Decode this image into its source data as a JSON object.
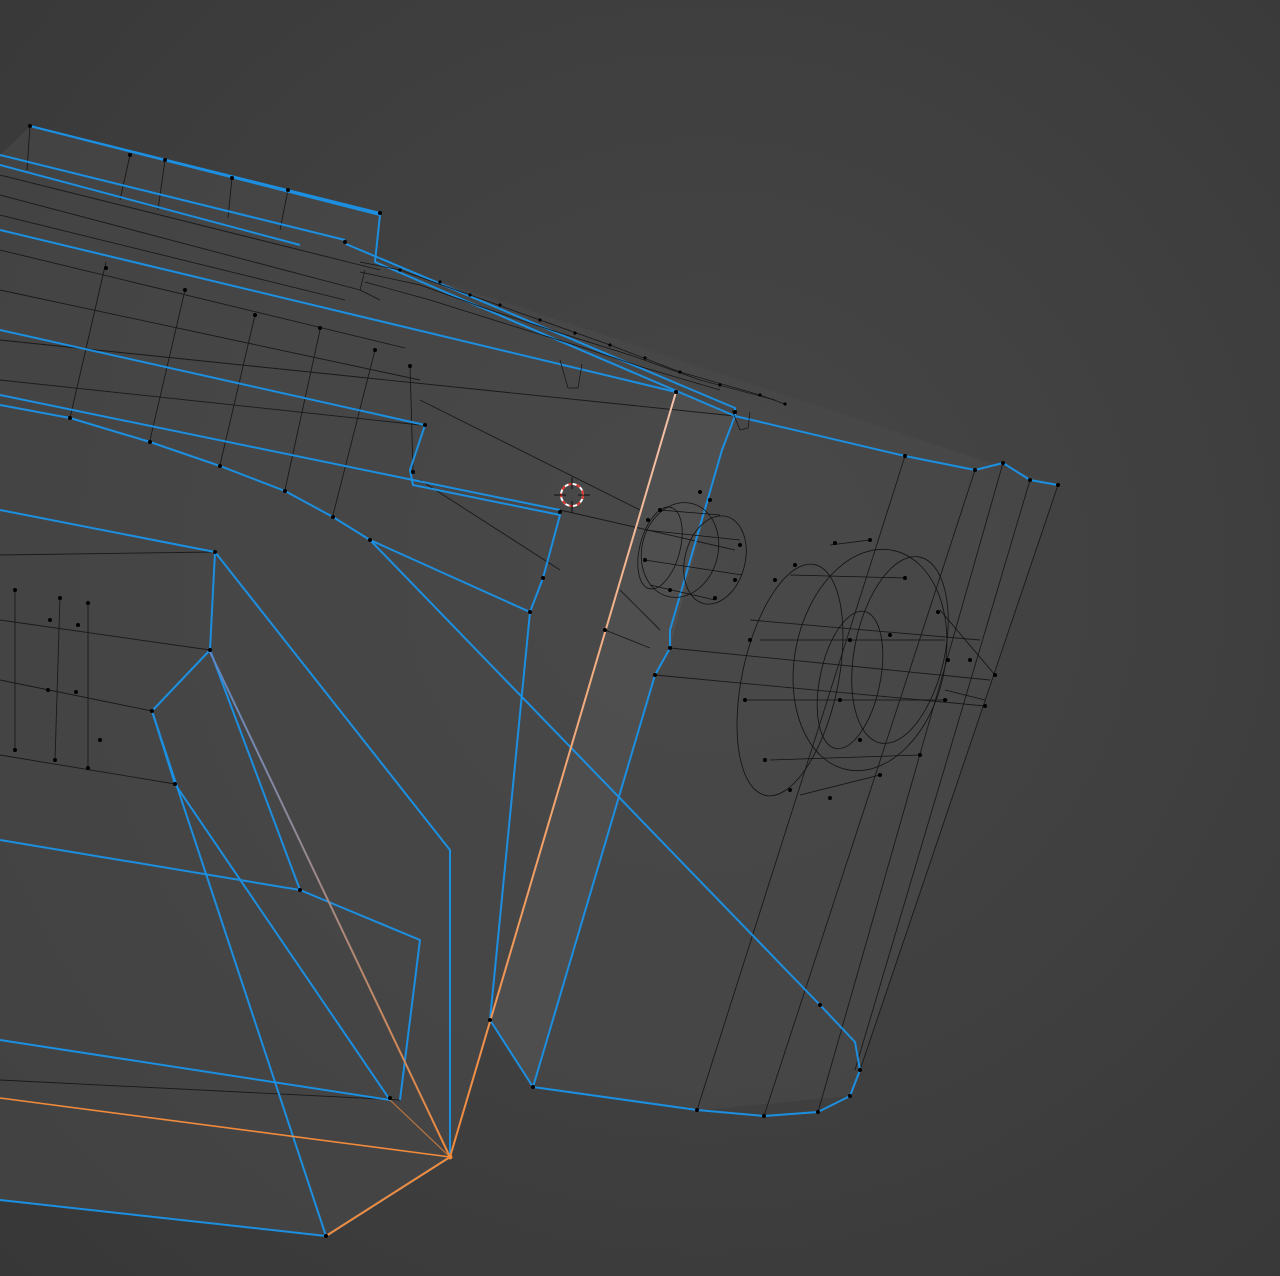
{
  "viewport": {
    "mode": "edit-mode-wireframe",
    "background_color": "#3d3d3d",
    "face_fill_color": "#4a4a4a",
    "wire_color": "#111111",
    "seam_color": "#1c8fe0",
    "selected_edge_color": "#f08a3c",
    "selected_edge_fade_color": "#f2b7a0",
    "vertex_color": "#000000",
    "cursor_color": "#e0332b"
  }
}
